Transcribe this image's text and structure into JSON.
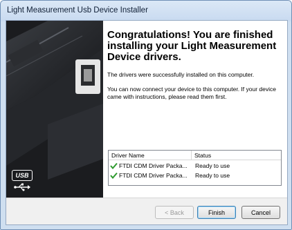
{
  "window": {
    "title": "Light Measurement Usb Device Installer"
  },
  "main": {
    "heading": "Congratulations! You are finished installing your Light Measurement Device drivers.",
    "message1": "The drivers were successfully installed on this computer.",
    "message2": "You can now connect your device to this computer. If your device came with instructions, please read them first."
  },
  "table": {
    "columns": [
      "Driver Name",
      "Status"
    ],
    "rows": [
      {
        "name": "FTDI CDM Driver Packa...",
        "status": "Ready to use",
        "icon": "check-icon"
      },
      {
        "name": "FTDI CDM Driver Packa...",
        "status": "Ready to use",
        "icon": "check-icon"
      }
    ]
  },
  "buttons": {
    "back": "< Back",
    "finish": "Finish",
    "cancel": "Cancel"
  },
  "usb_logo": {
    "text": "USB"
  },
  "colors": {
    "title_bar": "#c8daf0",
    "check_green": "#2e9a2e",
    "panel_dark": "#1d1f22"
  }
}
